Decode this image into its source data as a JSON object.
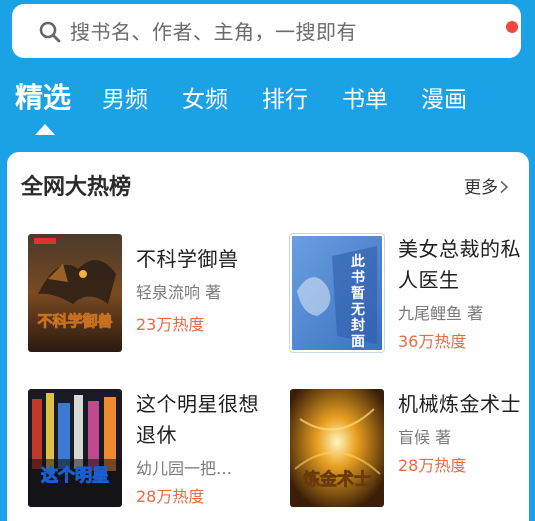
{
  "search": {
    "placeholder": "搜书名、作者、主角，一搜即有"
  },
  "tabs": [
    {
      "label": "精选",
      "active": true
    },
    {
      "label": "男频"
    },
    {
      "label": "女频"
    },
    {
      "label": "排行"
    },
    {
      "label": "书单"
    },
    {
      "label": "漫画"
    }
  ],
  "section": {
    "title": "全网大热榜",
    "more_label": "更多"
  },
  "books": [
    {
      "title": "不科学御兽",
      "author": "轻泉流响 著",
      "heat": "23万热度",
      "cover_text": "不科学御兽"
    },
    {
      "title": "美女总裁的私人医生",
      "author": "九尾鲤鱼 著",
      "heat": "36万热度",
      "cover_text": "此书暂无封面"
    },
    {
      "title": "这个明星很想退休",
      "author": "幼儿园一把…",
      "heat": "28万热度",
      "cover_text": "这个明星"
    },
    {
      "title": "机械炼金术士",
      "author": "盲候 著",
      "heat": "28万热度",
      "cover_text": "炼金术士"
    }
  ],
  "colors": {
    "brand": "#1ba1e6",
    "heat": "#ea6a43",
    "notify": "#f0483e"
  }
}
